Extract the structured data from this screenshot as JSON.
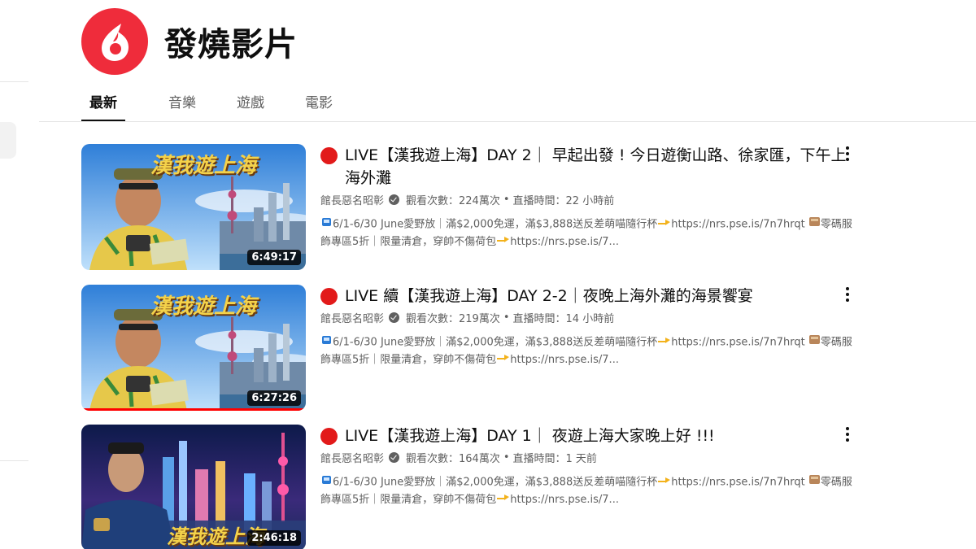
{
  "channel": {
    "name": "發燒影片",
    "logo_color": "#ef2c3b"
  },
  "tabs": [
    {
      "label": "最新",
      "active": true
    },
    {
      "label": "音樂",
      "active": false
    },
    {
      "label": "遊戲",
      "active": false
    },
    {
      "label": "電影",
      "active": false
    }
  ],
  "videos": [
    {
      "title": "LIVE【漢我遊上海】DAY 2｜ 早起出發 ! 今日遊衡山路、徐家匯，下午上海外灘",
      "channel": "館長惡名昭彰",
      "views": "觀看次數：224萬次",
      "sep": "•",
      "streamed": "直播時間：22 小時前",
      "desc_1": "6/1-6/30 June愛野放｜滿$2,000免運，滿$3,888送反差萌喵隨行杯",
      "desc_2": "https://nrs.pse.is/7n7hrqt",
      "desc_3": "零碼服飾專區5折｜限量清倉，穿帥不傷荷包",
      "desc_4": "https://nrs.pse.is/7...",
      "duration": "6:49:17",
      "thumb_text": "漢我遊上海",
      "watched": 0
    },
    {
      "title": "LIVE 續【漢我遊上海】DAY 2-2｜夜晚上海外灘的海景饗宴",
      "channel": "館長惡名昭彰",
      "views": "觀看次數：219萬次",
      "sep": "•",
      "streamed": "直播時間：14 小時前",
      "desc_1": "6/1-6/30 June愛野放｜滿$2,000免運，滿$3,888送反差萌喵隨行杯",
      "desc_2": "https://nrs.pse.is/7n7hrqt",
      "desc_3": "零碼服飾專區5折｜限量清倉，穿帥不傷荷包",
      "desc_4": "https://nrs.pse.is/7...",
      "duration": "6:27:26",
      "thumb_text": "漢我遊上海",
      "watched": 1
    },
    {
      "title": "LIVE【漢我遊上海】DAY 1｜ 夜遊上海大家晚上好 !!!",
      "channel": "館長惡名昭彰",
      "views": "觀看次數：164萬次",
      "sep": "•",
      "streamed": "直播時間：1 天前",
      "desc_1": "6/1-6/30 June愛野放｜滿$2,000免運，滿$3,888送反差萌喵隨行杯",
      "desc_2": "https://nrs.pse.is/7n7hrqt",
      "desc_3": "零碼服飾專區5折｜限量清倉，穿帥不傷荷包",
      "desc_4": "https://nrs.pse.is/7...",
      "duration": "2:46:18",
      "thumb_text": "漢我遊上海",
      "watched": 0
    }
  ]
}
